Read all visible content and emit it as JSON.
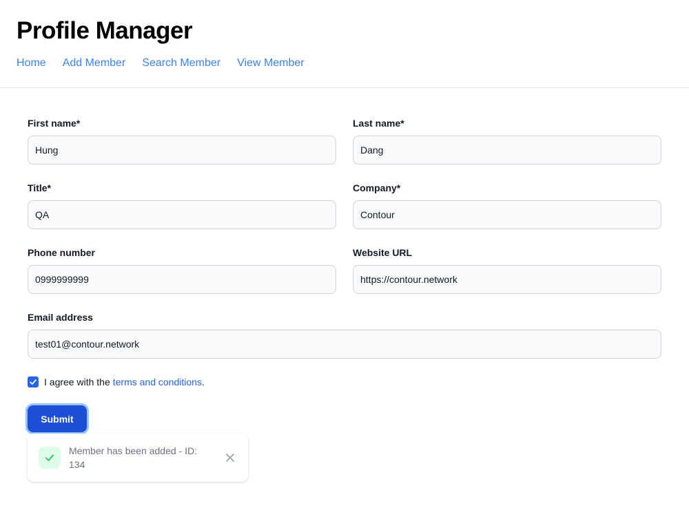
{
  "app": {
    "title": "Profile Manager"
  },
  "nav": {
    "items": [
      "Home",
      "Add Member",
      "Search Member",
      "View Member"
    ]
  },
  "form": {
    "first_name": {
      "label": "First name*",
      "value": "Hung"
    },
    "last_name": {
      "label": "Last name*",
      "value": "Dang"
    },
    "title": {
      "label": "Title*",
      "value": "QA"
    },
    "company": {
      "label": "Company*",
      "value": "Contour"
    },
    "phone": {
      "label": "Phone number",
      "value": "0999999999"
    },
    "website": {
      "label": "Website URL",
      "value": "https://contour.network"
    },
    "email": {
      "label": "Email address",
      "value": "test01@contour.network"
    },
    "agree": {
      "checked": true,
      "text_before": "I agree with the",
      "link": "terms and conditions",
      "text_after": "."
    },
    "submit_label": "Submit"
  },
  "toast": {
    "message": "Member has been added - ID: 134",
    "icon": "check-icon",
    "close_icon": "close-icon"
  },
  "colors": {
    "accent": "#1d4ed8",
    "link": "#3b82f6",
    "success_bg": "#dcfce7",
    "success": "#22c55e"
  }
}
